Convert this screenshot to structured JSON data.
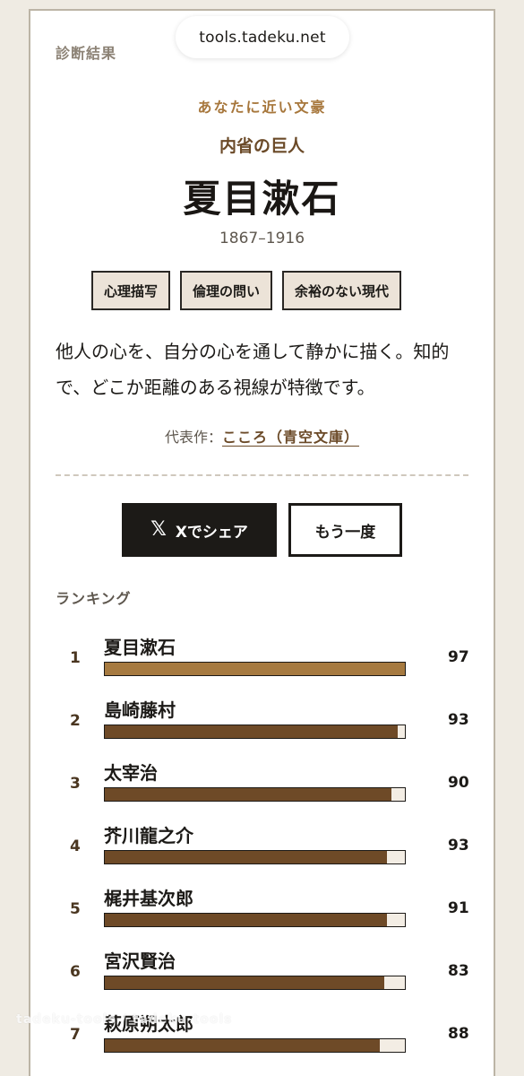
{
  "browser": {
    "url": "tools.tadeku.net"
  },
  "header": {
    "label": "診断結果"
  },
  "result": {
    "eyebrow": "あなたに近い文豪",
    "subtitle": "内省の巨人",
    "name": "夏目漱石",
    "years": "1867–1916",
    "tags": [
      "心理描写",
      "倫理の問い",
      "余裕のない現代"
    ],
    "description": "他人の心を、自分の心を通して静かに描く。知的で、どこか距離のある視線が特徴です。",
    "representative_label": "代表作：",
    "representative_work": "こころ（青空文庫）"
  },
  "actions": {
    "share_label": "Xでシェア",
    "share_icon": "x-logo-icon",
    "retry_label": "もう一度"
  },
  "ranking": {
    "heading": "ランキング",
    "highlight_color": "#a67a40",
    "bar_color": "#6e4a27",
    "items": [
      {
        "rank": "1",
        "name": "夏目漱石",
        "score": "97",
        "fill": 1.0
      },
      {
        "rank": "2",
        "name": "島崎藤村",
        "score": "93",
        "fill": 0.975
      },
      {
        "rank": "3",
        "name": "太宰治",
        "score": "90",
        "fill": 0.955
      },
      {
        "rank": "4",
        "name": "芥川龍之介",
        "score": "93",
        "fill": 0.94
      },
      {
        "rank": "5",
        "name": "梶井基次郎",
        "score": "91",
        "fill": 0.94
      },
      {
        "rank": "6",
        "name": "宮沢賢治",
        "score": "83",
        "fill": 0.93
      },
      {
        "rank": "7",
        "name": "萩原朔太郎",
        "score": "88",
        "fill": 0.915
      }
    ]
  },
  "watermark": "tadeku-tools / tadeku-tools"
}
